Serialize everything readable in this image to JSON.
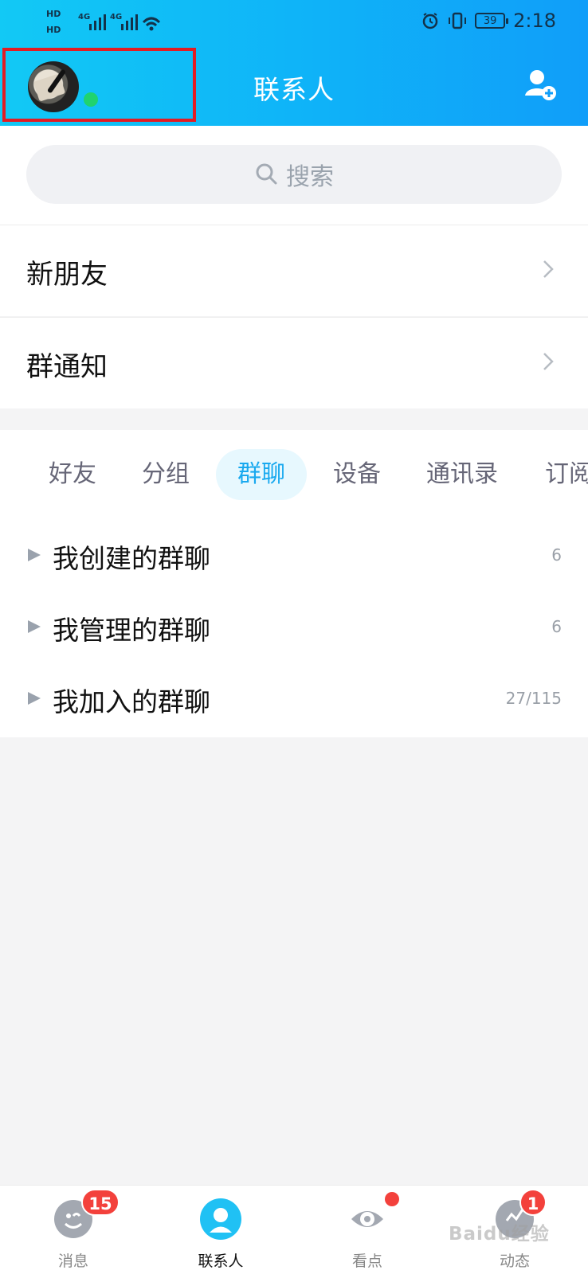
{
  "status": {
    "network_tags": [
      "HD",
      "HD"
    ],
    "signal_labels": [
      "4G",
      "4G"
    ],
    "battery": "39",
    "time": "2:18"
  },
  "header": {
    "title": "联系人"
  },
  "search": {
    "placeholder": "搜索"
  },
  "rows": [
    {
      "label": "新朋友"
    },
    {
      "label": "群通知"
    }
  ],
  "tabs": [
    {
      "label": "好友"
    },
    {
      "label": "分组"
    },
    {
      "label": "群聊"
    },
    {
      "label": "设备"
    },
    {
      "label": "通讯录"
    },
    {
      "label": "订阅"
    }
  ],
  "groups": [
    {
      "label": "我创建的群聊",
      "count": "6"
    },
    {
      "label": "我管理的群聊",
      "count": "6"
    },
    {
      "label": "我加入的群聊",
      "count": "27/115"
    }
  ],
  "bottom_nav": [
    {
      "label": "消息",
      "badge": "15"
    },
    {
      "label": "联系人"
    },
    {
      "label": "看点"
    },
    {
      "label": "动态",
      "badge": "1"
    }
  ],
  "watermark": "Baidu经验",
  "colors": {
    "header_start": "#12c9f5",
    "header_end": "#109ef9",
    "accent": "#19a9ef",
    "badge": "#f3413c"
  }
}
